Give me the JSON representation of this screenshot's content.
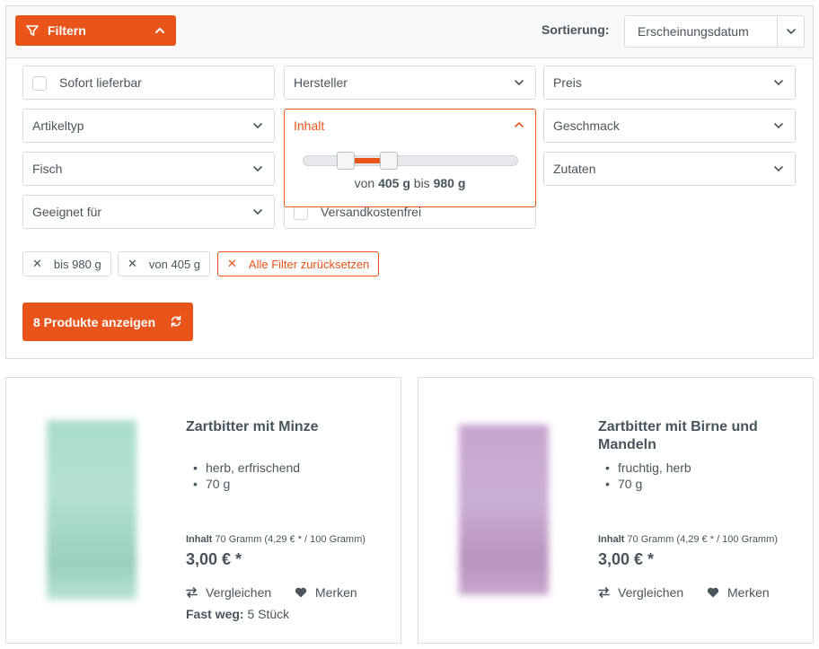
{
  "filter_bar": {
    "toggle_label": "Filtern",
    "sort_label": "Sortierung:",
    "sort_value": "Erscheinungsdatum"
  },
  "filters": {
    "sofort": "Sofort lieferbar",
    "hersteller": "Hersteller",
    "preis": "Preis",
    "artikeltyp": "Artikeltyp",
    "inhalt": "Inhalt",
    "geschmack": "Geschmack",
    "fisch": "Fisch",
    "zutaten": "Zutaten",
    "geeignet": "Geeignet für",
    "versand": "Versandkostenfrei"
  },
  "inhalt_range": {
    "prefix": "von",
    "min": "405 g",
    "middle": "bis",
    "max": "980 g",
    "min_fraction": 0.2,
    "max_fraction": 0.4
  },
  "active_filters": [
    {
      "label": "bis 980 g"
    },
    {
      "label": "von 405 g"
    }
  ],
  "reset_label": "Alle Filter zurücksetzen",
  "show_button": "8 Produkte anzeigen",
  "products": [
    {
      "title": "Zartbitter mit Minze",
      "bullets": [
        "herb, erfrischend",
        "70 g"
      ],
      "unit_label": "Inhalt",
      "unit_text": "70 Gramm (4,29 € * / 100 Gramm)",
      "price": "3,00 € *",
      "compare": "Vergleichen",
      "wishlist": "Merken",
      "stock_label": "Fast weg:",
      "stock_value": "5 Stück",
      "image_color": "#a9dccd"
    },
    {
      "title": "Zartbitter mit Birne und Mandeln",
      "bullets": [
        "fruchtig, herb",
        "70 g"
      ],
      "unit_label": "Inhalt",
      "unit_text": "70 Gramm (4,29 € * / 100 Gramm)",
      "price": "3,00 € *",
      "compare": "Vergleichen",
      "wishlist": "Merken",
      "image_color": "#c6a5cf"
    }
  ],
  "colors": {
    "accent": "#e9541b",
    "text": "#4a545b",
    "border": "#dadae5"
  }
}
